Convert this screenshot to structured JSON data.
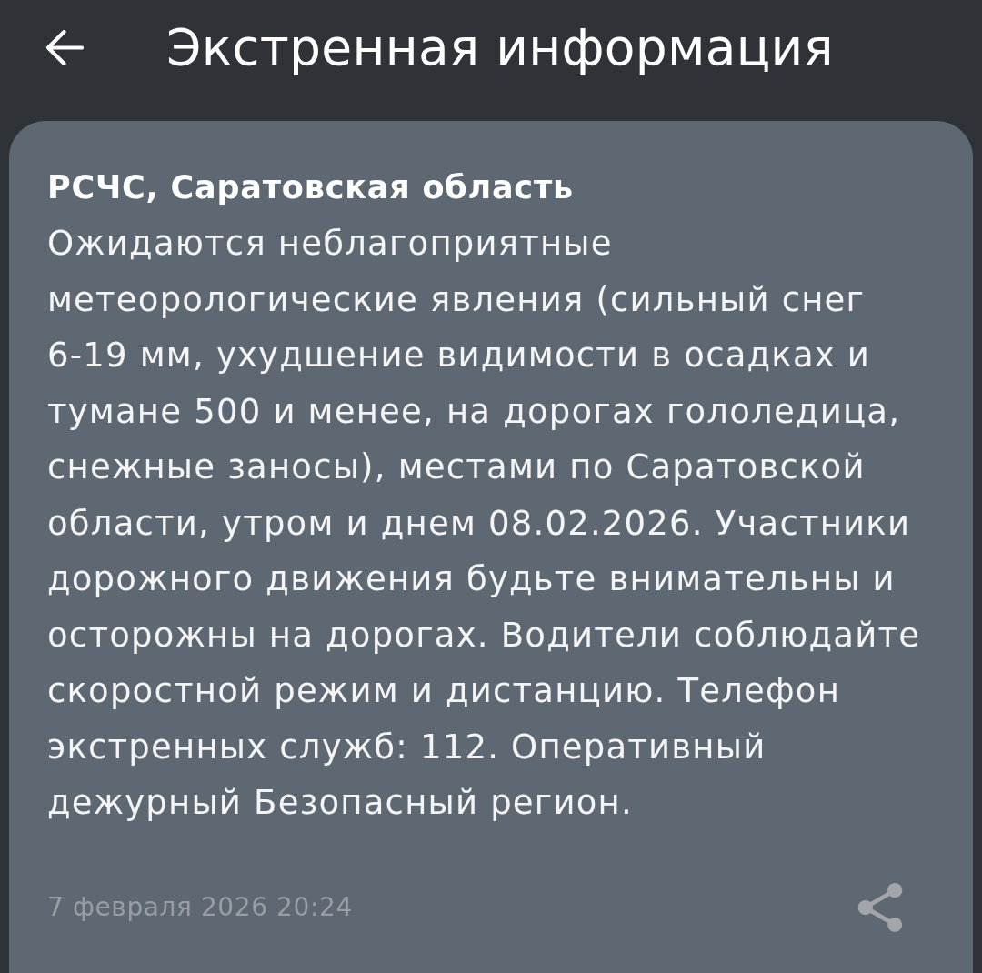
{
  "header": {
    "title": "Экстренная информация"
  },
  "alert": {
    "sender": "РСЧС, Саратовская область",
    "message": "Ожидаются неблагоприятные метеорологические явления (сильный снег 6-19 мм, ухудшение видимости в осадках и тумане 500 и менее, на дорогах гололедица, снежные заносы), местами по Саратовской области, утром и днем 08.02.2026. Участники дорожного движения будьте внимательны и осторожны на дорогах. Водители соблюдайте скоростной режим и дистанцию. Телефон экстренных служб: 112. Оперативный дежурный Безопасный регион.",
    "timestamp": "7 февраля 2026 20:24"
  }
}
